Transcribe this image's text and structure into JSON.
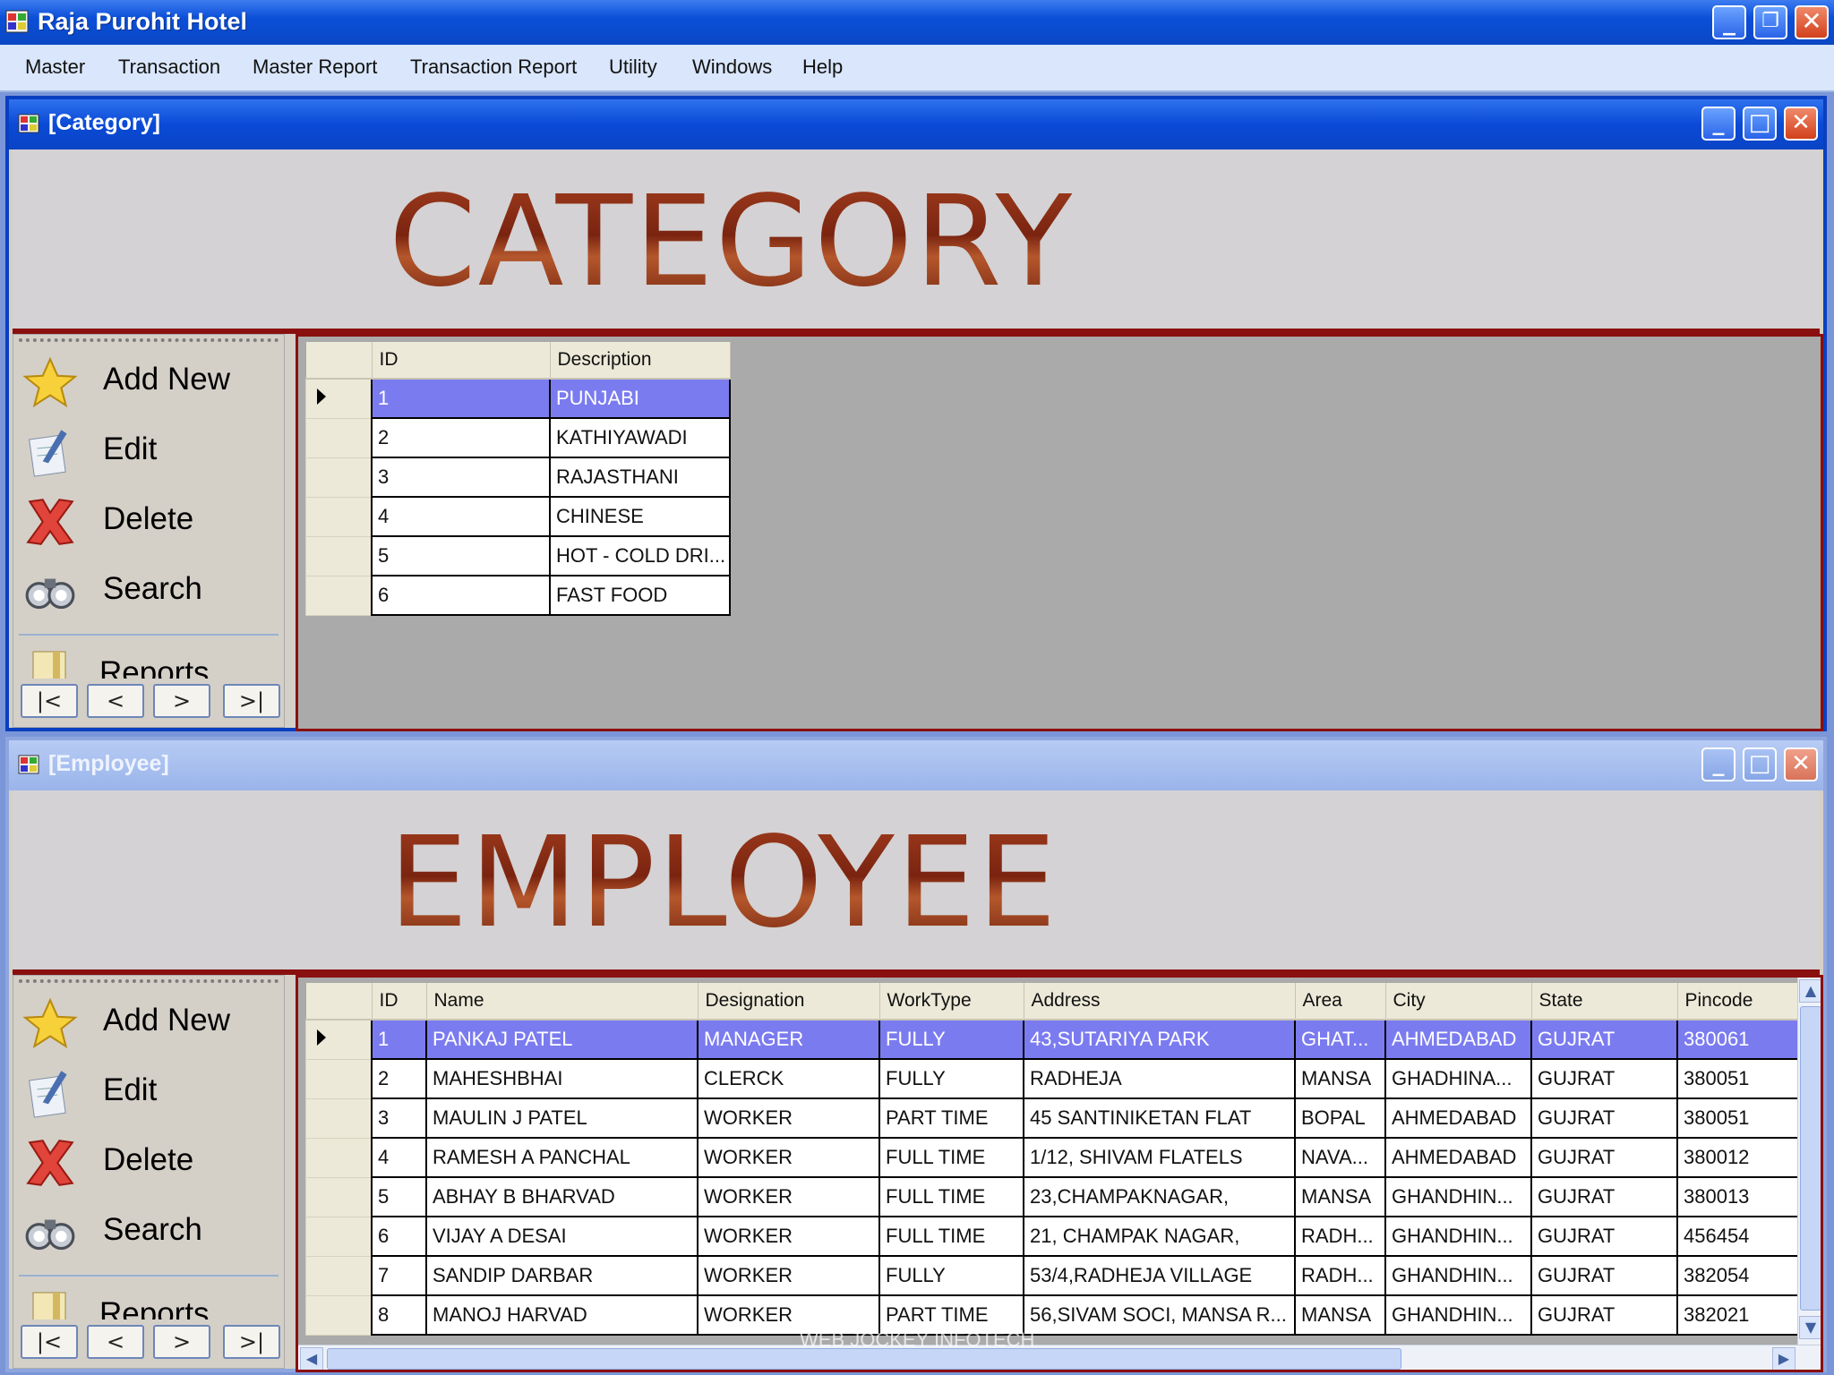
{
  "app": {
    "title": "Raja Purohit Hotel"
  },
  "menu": [
    "Master",
    "Transaction",
    "Master Report",
    "Transaction Report",
    "Utility",
    "Windows",
    "Help"
  ],
  "category_window": {
    "title": "[Category]",
    "banner": "CATEGORY",
    "sidebar": {
      "add": "Add New",
      "edit": "Edit",
      "delete": "Delete",
      "search": "Search",
      "reports": "Reports"
    },
    "nav": {
      "first": "|<",
      "prev": "<",
      "next": ">",
      "last": ">|"
    },
    "columns": [
      "ID",
      "Description"
    ],
    "rows": [
      [
        "1",
        "PUNJABI"
      ],
      [
        "2",
        "KATHIYAWADI"
      ],
      [
        "3",
        "RAJASTHANI"
      ],
      [
        "4",
        "CHINESE"
      ],
      [
        "5",
        "HOT - COLD DRI..."
      ],
      [
        "6",
        "FAST FOOD"
      ]
    ]
  },
  "employee_window": {
    "title": "[Employee]",
    "banner": "EMPLOYEE",
    "sidebar": {
      "add": "Add New",
      "edit": "Edit",
      "delete": "Delete",
      "search": "Search",
      "reports": "Reports"
    },
    "nav": {
      "first": "|<",
      "prev": "<",
      "next": ">",
      "last": ">|"
    },
    "columns": [
      "ID",
      "Name",
      "Designation",
      "WorkType",
      "Address",
      "Area",
      "City",
      "State",
      "Pincode"
    ],
    "rows": [
      [
        "1",
        "PANKAJ PATEL",
        "MANAGER",
        "FULLY",
        "43,SUTARIYA PARK",
        "GHAT...",
        "AHMEDABAD",
        "GUJRAT",
        "380061"
      ],
      [
        "2",
        "MAHESHBHAI",
        "CLERCK",
        "FULLY",
        "RADHEJA",
        "MANSA",
        "GHADHINA...",
        "GUJRAT",
        "380051"
      ],
      [
        "3",
        "MAULIN J PATEL",
        "WORKER",
        "PART TIME",
        "45 SANTINIKETAN FLAT",
        "BOPAL",
        "AHMEDABAD",
        "GUJRAT",
        "380051"
      ],
      [
        "4",
        "RAMESH A PANCHAL",
        "WORKER",
        "FULL TIME",
        "1/12, SHIVAM FLATELS",
        "NAVA...",
        "AHMEDABAD",
        "GUJRAT",
        "380012"
      ],
      [
        "5",
        "ABHAY B BHARVAD",
        "WORKER",
        "FULL TIME",
        "23,CHAMPAKNAGAR,",
        "MANSA",
        "GHANDHIN...",
        "GUJRAT",
        "380013"
      ],
      [
        "6",
        "VIJAY A DESAI",
        "WORKER",
        "FULL TIME",
        "21, CHAMPAK NAGAR,",
        "RADH...",
        "GHANDHIN...",
        "GUJRAT",
        "456454"
      ],
      [
        "7",
        "SANDIP DARBAR",
        "WORKER",
        "FULLY",
        "53/4,RADHEJA VILLAGE",
        "RADH...",
        "GHANDHIN...",
        "GUJRAT",
        "382054"
      ],
      [
        "8",
        "MANOJ HARVAD",
        "WORKER",
        "PART TIME",
        "56,SIVAM SOCI, MANSA R...",
        "MANSA",
        "GHANDHIN...",
        "GUJRAT",
        "382021"
      ]
    ],
    "watermark": "WEB JOCKEY INFOTECH"
  },
  "colors": {
    "titlebar": "#0a4ad6",
    "selection": "#7b7bf0",
    "banner_border": "#8a0f0f",
    "close": "#d2401c"
  },
  "icons": {
    "app": "app-window-icon",
    "add": "star-icon",
    "edit": "edit-notepad-icon",
    "delete": "red-x-icon",
    "search": "binoculars-icon",
    "reports": "reports-icon"
  }
}
